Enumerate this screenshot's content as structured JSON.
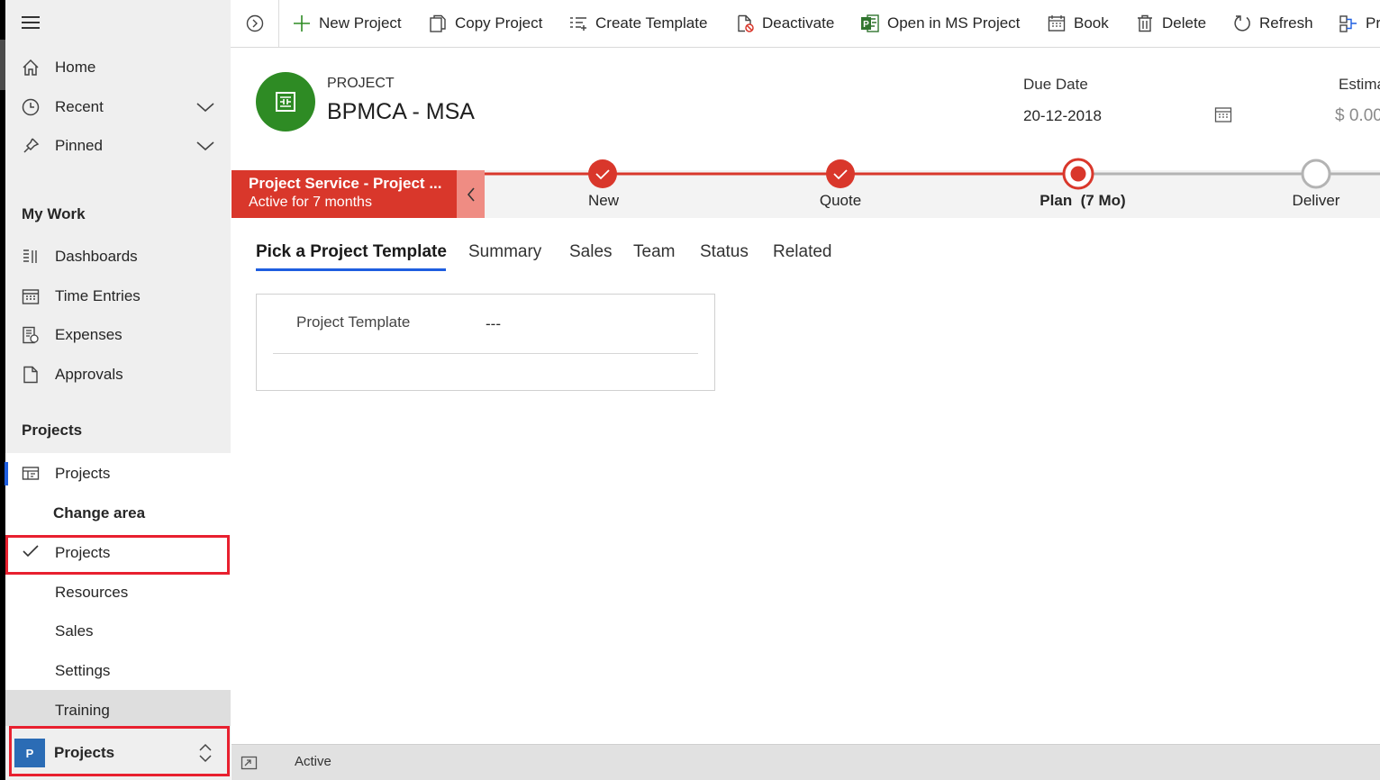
{
  "sidebar": {
    "nav": [
      {
        "label": "Home",
        "icon": "home-icon"
      },
      {
        "label": "Recent",
        "icon": "clock-icon"
      },
      {
        "label": "Pinned",
        "icon": "pin-icon"
      }
    ],
    "my_work_header": "My Work",
    "my_work": [
      {
        "label": "Dashboards",
        "icon": "dashboard-icon"
      },
      {
        "label": "Time Entries",
        "icon": "calendar-icon"
      },
      {
        "label": "Expenses",
        "icon": "expense-icon"
      },
      {
        "label": "Approvals",
        "icon": "document-icon"
      }
    ],
    "projects_header": "Projects",
    "projects_item": "Projects",
    "change_area": {
      "title": "Change area",
      "items": [
        "Projects",
        "Resources",
        "Sales",
        "Settings",
        "Training"
      ],
      "selected": "Projects"
    },
    "area_switcher": {
      "badge": "P",
      "label": "Projects"
    }
  },
  "commands": [
    {
      "label": "New Project",
      "icon": "plus-icon"
    },
    {
      "label": "Copy Project",
      "icon": "copy-icon"
    },
    {
      "label": "Create Template",
      "icon": "template-icon"
    },
    {
      "label": "Deactivate",
      "icon": "deactivate-icon"
    },
    {
      "label": "Open in MS Project",
      "icon": "ms-project-icon"
    },
    {
      "label": "Book",
      "icon": "book-calendar-icon"
    },
    {
      "label": "Delete",
      "icon": "trash-icon"
    },
    {
      "label": "Refresh",
      "icon": "refresh-icon"
    },
    {
      "label": "Pr",
      "icon": "process-icon"
    }
  ],
  "header": {
    "entity_type": "PROJECT",
    "entity_name": "BPMCA - MSA",
    "due_date_label": "Due Date",
    "due_date_value": "20-12-2018",
    "estimate_label": "Estima",
    "estimate_value": "$ 0.00"
  },
  "process": {
    "active_title": "Project Service - Project ...",
    "active_subtitle": "Active for 7 months",
    "stages": [
      {
        "label": "New",
        "state": "done"
      },
      {
        "label": "Quote",
        "state": "done"
      },
      {
        "label": "Plan  (7 Mo)",
        "state": "current"
      },
      {
        "label": "Deliver",
        "state": "pending"
      }
    ]
  },
  "tabs": [
    "Pick a Project Template",
    "Summary",
    "Sales",
    "Team",
    "Status",
    "Related"
  ],
  "active_tab": "Pick a Project Template",
  "form": {
    "field_label": "Project Template",
    "field_value": "---"
  },
  "status_bar": {
    "status": "Active"
  },
  "colors": {
    "accent": "#1e5ee0",
    "process_red": "#d9372b",
    "avatar_green": "#2e8b24",
    "highlight_red": "#e8202f"
  }
}
